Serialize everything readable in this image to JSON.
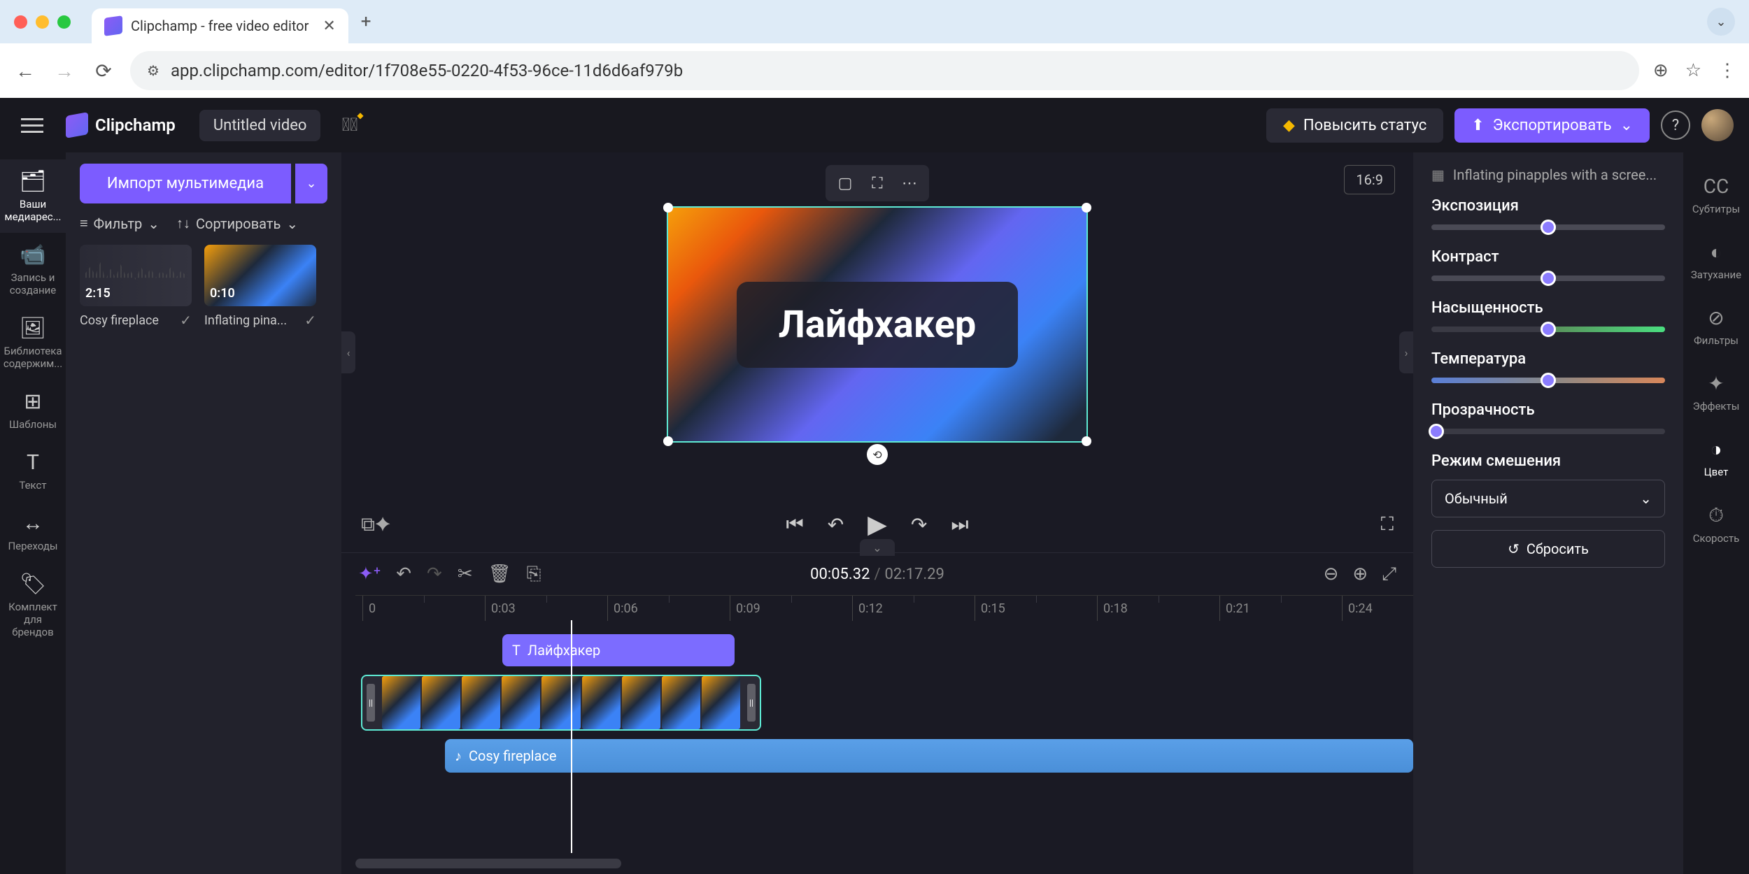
{
  "browser": {
    "tab_title": "Clipchamp - free video editor",
    "url": "app.clipchamp.com/editor/1f708e55-0220-4f53-96ce-11d6d6af979b"
  },
  "header": {
    "app_name": "Clipchamp",
    "project_name": "Untitled video",
    "upgrade_label": "Повысить статус",
    "export_label": "Экспортировать"
  },
  "left_rail": [
    {
      "icon": "🗂",
      "label": "Ваши медиарес..."
    },
    {
      "icon": "📹",
      "label": "Запись и создание"
    },
    {
      "icon": "🖼",
      "label": "Библиотека содержим..."
    },
    {
      "icon": "⊞",
      "label": "Шаблоны"
    },
    {
      "icon": "T",
      "label": "Текст"
    },
    {
      "icon": "↔",
      "label": "Переходы"
    },
    {
      "icon": "🏷",
      "label": "Комплект для брендов"
    }
  ],
  "media_panel": {
    "import_label": "Импорт мультимедиа",
    "filter_label": "Фильтр",
    "sort_label": "Сортировать",
    "items": [
      {
        "duration": "2:15",
        "name": "Cosy fireplace",
        "type": "audio"
      },
      {
        "duration": "0:10",
        "name": "Inflating pina...",
        "type": "video"
      }
    ]
  },
  "preview": {
    "aspect_ratio": "16:9",
    "overlay_text": "Лайфхакер"
  },
  "playback": {
    "current_time": "00:05.32",
    "total_time": "02:17.29"
  },
  "timeline": {
    "ticks": [
      "0",
      "0:03",
      "0:06",
      "0:09",
      "0:12",
      "0:15",
      "0:18",
      "0:21",
      "0:24"
    ],
    "text_clip_label": "Лайфхакер",
    "audio_clip_label": "Cosy fireplace"
  },
  "props": {
    "clip_name": "Inflating pinapples with a scree...",
    "exposure_label": "Экспозиция",
    "contrast_label": "Контраст",
    "saturation_label": "Насыщенность",
    "temperature_label": "Температура",
    "opacity_label": "Прозрачность",
    "blend_label": "Режим смешения",
    "blend_value": "Обычный",
    "reset_label": "Сбросить",
    "sliders": {
      "exposure": 50,
      "contrast": 50,
      "saturation": 50,
      "temperature": 50,
      "opacity": 0
    }
  },
  "right_rail": [
    {
      "icon": "CC",
      "label": "Субтитры"
    },
    {
      "icon": "◐",
      "label": "Затухание"
    },
    {
      "icon": "⊘",
      "label": "Фильтры"
    },
    {
      "icon": "✦",
      "label": "Эффекты"
    },
    {
      "icon": "◑",
      "label": "Цвет"
    },
    {
      "icon": "⏱",
      "label": "Скорость"
    }
  ]
}
